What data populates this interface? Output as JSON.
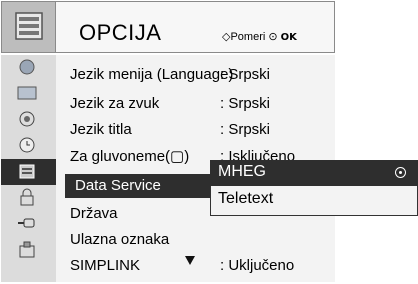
{
  "header": {
    "title": "OPCIJA",
    "hint_move": "Pomeri",
    "hint_ok": "OK",
    "move_glyph": "◇",
    "ok_glyph": "⊙"
  },
  "icons": [
    "picture-icon",
    "screen-icon",
    "audio-icon",
    "time-icon",
    "option-icon",
    "lock-icon",
    "input-icon",
    "usb-icon"
  ],
  "menu": {
    "items": [
      {
        "label": "Jezik menija (Language)",
        "value": ": Srpski"
      },
      {
        "label": "Jezik za zvuk",
        "value": ": Srpski"
      },
      {
        "label": "Jezik titla",
        "value": ": Srpski"
      },
      {
        "label": "Za gluvoneme(▢)",
        "value": ": Isključeno"
      },
      {
        "label": "Data Service",
        "value": ""
      },
      {
        "label": "Država",
        "value": ""
      },
      {
        "label": "Ulazna oznaka",
        "value": ""
      },
      {
        "label": "SIMPLINK",
        "value": ": Uključeno"
      }
    ],
    "selected": "Data Service"
  },
  "popup": {
    "options": [
      "MHEG",
      "Teletext"
    ],
    "selected": "MHEG"
  },
  "colors": {
    "selection": "#2e2e2e",
    "panel": "#f3f3f3",
    "icon_column": "#dcdcdc"
  }
}
